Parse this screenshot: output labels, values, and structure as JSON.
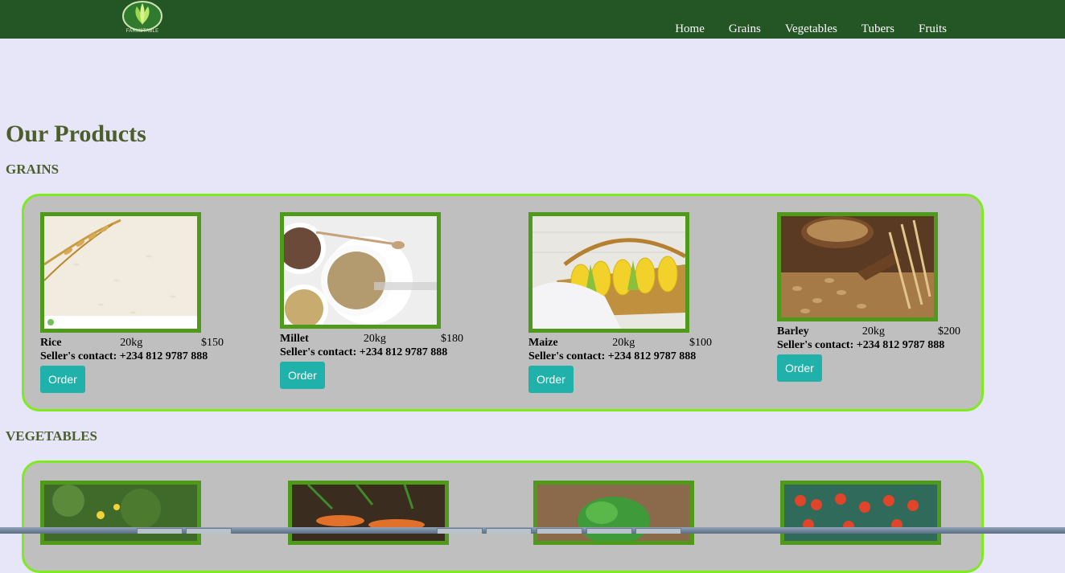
{
  "header": {
    "logo_text": "FARM2TABLE",
    "nav": [
      "Home",
      "Grains",
      "Vegetables",
      "Tubers",
      "Fruits"
    ]
  },
  "page_title": "Our Products",
  "sections": {
    "grains": {
      "title": "GRAINS",
      "items": [
        {
          "name": "Rice",
          "weight": "20kg",
          "price": "$150",
          "contact": "Seller's contact: +234 812 9787 888",
          "button": "Order"
        },
        {
          "name": "Millet",
          "weight": "20kg",
          "price": "$180",
          "contact": "Seller's contact: +234 812 9787 888",
          "button": "Order"
        },
        {
          "name": "Maize",
          "weight": "20kg",
          "price": "$100",
          "contact": "Seller's contact: +234 812 9787 888",
          "button": "Order"
        },
        {
          "name": "Barley",
          "weight": "20kg",
          "price": "$200",
          "contact": "Seller's contact: +234 812 9787 888",
          "button": "Order"
        }
      ]
    },
    "vegetables": {
      "title": "VEGETABLES"
    }
  },
  "colors": {
    "header_bg": "#245524",
    "page_bg": "#e6e6f8",
    "panel_bg": "#bfbfbf",
    "panel_border": "#7fea20",
    "image_border": "#4f9a1a",
    "button": "#20b2aa",
    "heading": "#4d5e2c"
  }
}
